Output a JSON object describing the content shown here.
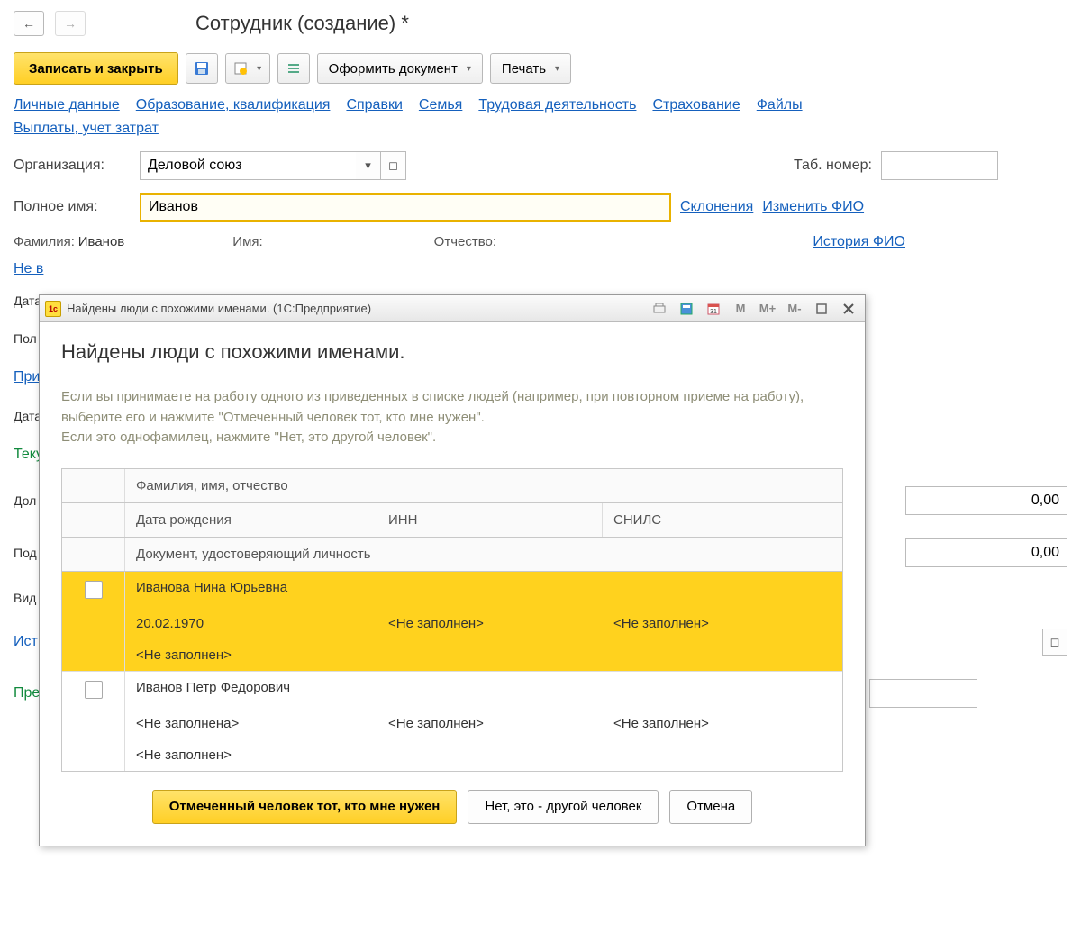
{
  "header": {
    "title": "Сотрудник (создание) *"
  },
  "toolbar": {
    "save_close": "Записать и закрыть",
    "doc_button": "Оформить документ",
    "print": "Печать"
  },
  "links": {
    "l1": "Личные данные",
    "l2": "Образование, квалификация",
    "l3": "Справки",
    "l4": "Семья",
    "l5": "Трудовая деятельность",
    "l6": "Страхование",
    "l7": "Файлы",
    "l8": "Выплаты, учет затрат"
  },
  "form": {
    "org_label": "Организация:",
    "org_value": "Деловой союз",
    "tabnum_label": "Таб. номер:",
    "fullname_label": "Полное имя:",
    "fullname_value": "Иванов",
    "declensions": "Склонения",
    "change_fio": "Изменить ФИО",
    "surname_label": "Фамилия:",
    "surname_value": "Иванов",
    "name_label": "Имя:",
    "patronymic_label": "Отчество:",
    "history_fio": "История ФИО",
    "not_in": "Не в",
    "data_label": "Дата",
    "pol_label": "Пол",
    "pri_label": "При",
    "tek_label": "Теку",
    "dol_label": "Дол",
    "pod_label": "Под",
    "vid_label": "Вид",
    "ist_label": "Ист",
    "pred_label": "Пре",
    "zero": "0,00"
  },
  "modal": {
    "title_small": "Найдены люди с похожими именами.  (1С:Предприятие)",
    "heading": "Найдены люди с похожими именами.",
    "desc1": "Если вы принимаете на работу одного из приведенных в списке людей (например, при повторном приеме на работу), выберите его и нажмите \"Отмеченный человек тот, кто мне нужен\".",
    "desc2": "Если это однофамилец, нажмите \"Нет, это другой человек\".",
    "m": "M",
    "mplus": "M+",
    "mminus": "M-",
    "hdr_fio": "Фамилия, имя, отчество",
    "hdr_dob": "Дата рождения",
    "hdr_inn": "ИНН",
    "hdr_snils": "СНИЛС",
    "hdr_doc": "Документ, удостоверяющий личность",
    "rows": [
      {
        "fio": "Иванова Нина Юрьевна",
        "dob": "20.02.1970",
        "inn": "<Не заполнен>",
        "snils": "<Не заполнен>",
        "doc": "<Не заполнен>",
        "selected": true
      },
      {
        "fio": "Иванов Петр Федорович",
        "dob": "<Не заполнена>",
        "inn": "<Не заполнен>",
        "snils": "<Не заполнен>",
        "doc": "<Не заполнен>",
        "selected": false
      }
    ],
    "btn_primary": "Отмеченный человек тот, кто мне нужен",
    "btn_other": "Нет, это - другой человек",
    "btn_cancel": "Отмена"
  }
}
